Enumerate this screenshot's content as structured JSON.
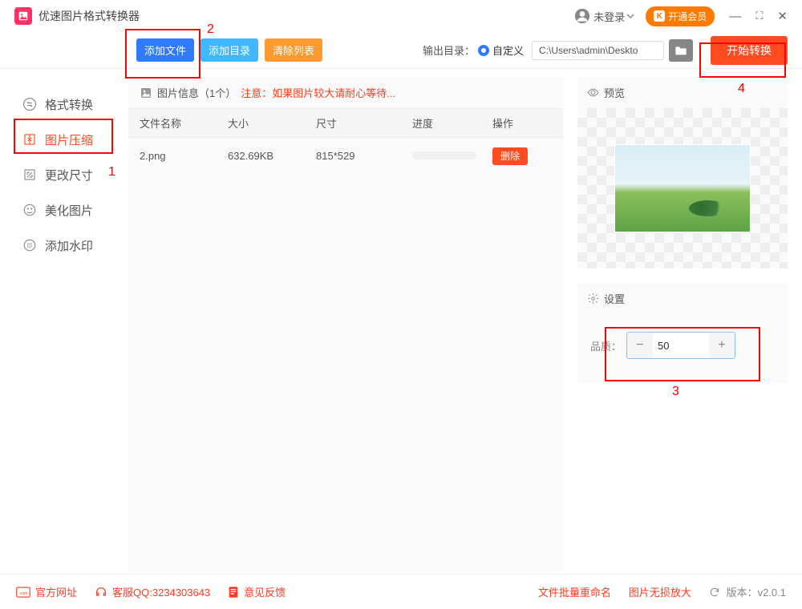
{
  "app": {
    "title": "优速图片格式转换器"
  },
  "user": {
    "status": "未登录",
    "vip_button": "开通会员"
  },
  "toolbar": {
    "add_file": "添加文件",
    "add_dir": "添加目录",
    "clear": "清除列表",
    "out_label": "输出目录：",
    "out_custom": "自定义",
    "out_path": "C:\\Users\\admin\\Deskto",
    "start": "开始转换"
  },
  "sidebar": {
    "items": [
      {
        "label": "格式转换"
      },
      {
        "label": "图片压缩"
      },
      {
        "label": "更改尺寸"
      },
      {
        "label": "美化图片"
      },
      {
        "label": "添加水印"
      }
    ],
    "active_index": 1
  },
  "filelist": {
    "info_label": "图片信息（1个）",
    "info_warn": "注意：如果图片较大请耐心等待...",
    "headers": {
      "name": "文件名称",
      "size": "大小",
      "dim": "尺寸",
      "prog": "进度",
      "op": "操作"
    },
    "rows": [
      {
        "name": "2.png",
        "size": "632.69KB",
        "dim": "815*529",
        "op": "删除"
      }
    ]
  },
  "preview": {
    "title": "预览"
  },
  "settings": {
    "title": "设置",
    "quality_label": "品质：",
    "quality_value": "50"
  },
  "footer": {
    "site": "官方网址",
    "qq": "客服QQ:3234303643",
    "feedback": "意见反馈",
    "rename": "文件批量重命名",
    "enlarge": "图片无损放大",
    "version_label": "版本：",
    "version": "v2.0.1"
  },
  "callouts": {
    "1": "1",
    "2": "2",
    "3": "3",
    "4": "4"
  }
}
